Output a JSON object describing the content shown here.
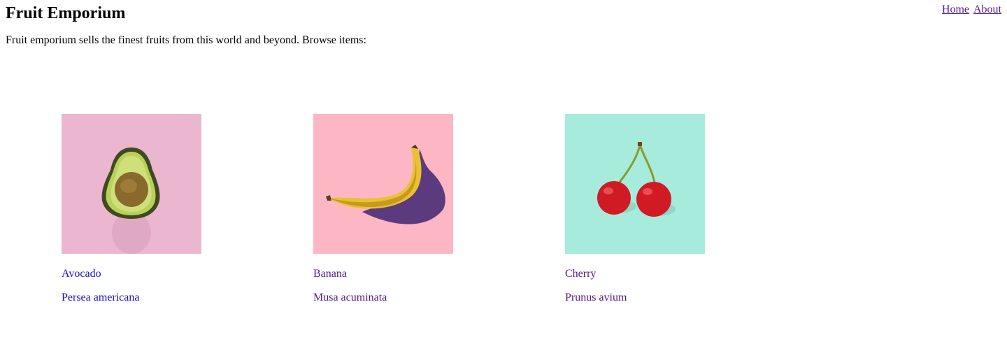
{
  "site": {
    "title": "Fruit Emporium",
    "intro": "Fruit emporium sells the finest fruits from this world and beyond. Browse items:"
  },
  "nav": {
    "home": "Home",
    "about": "About"
  },
  "colors": {
    "link_unvisited": "#1a0dd9",
    "link_visited": "#551a8b",
    "avocado_bg": "#ebb6cf",
    "banana_bg": "#fdb6c4",
    "cherry_bg": "#a6ebdc"
  },
  "products": [
    {
      "name": "Avocado",
      "latin": "Persea americana",
      "image": "avocado-photo",
      "visited": false
    },
    {
      "name": "Banana",
      "latin": "Musa acuminata",
      "image": "banana-photo",
      "visited": true
    },
    {
      "name": "Cherry",
      "latin": "Prunus avium",
      "image": "cherry-photo",
      "visited": true
    }
  ]
}
